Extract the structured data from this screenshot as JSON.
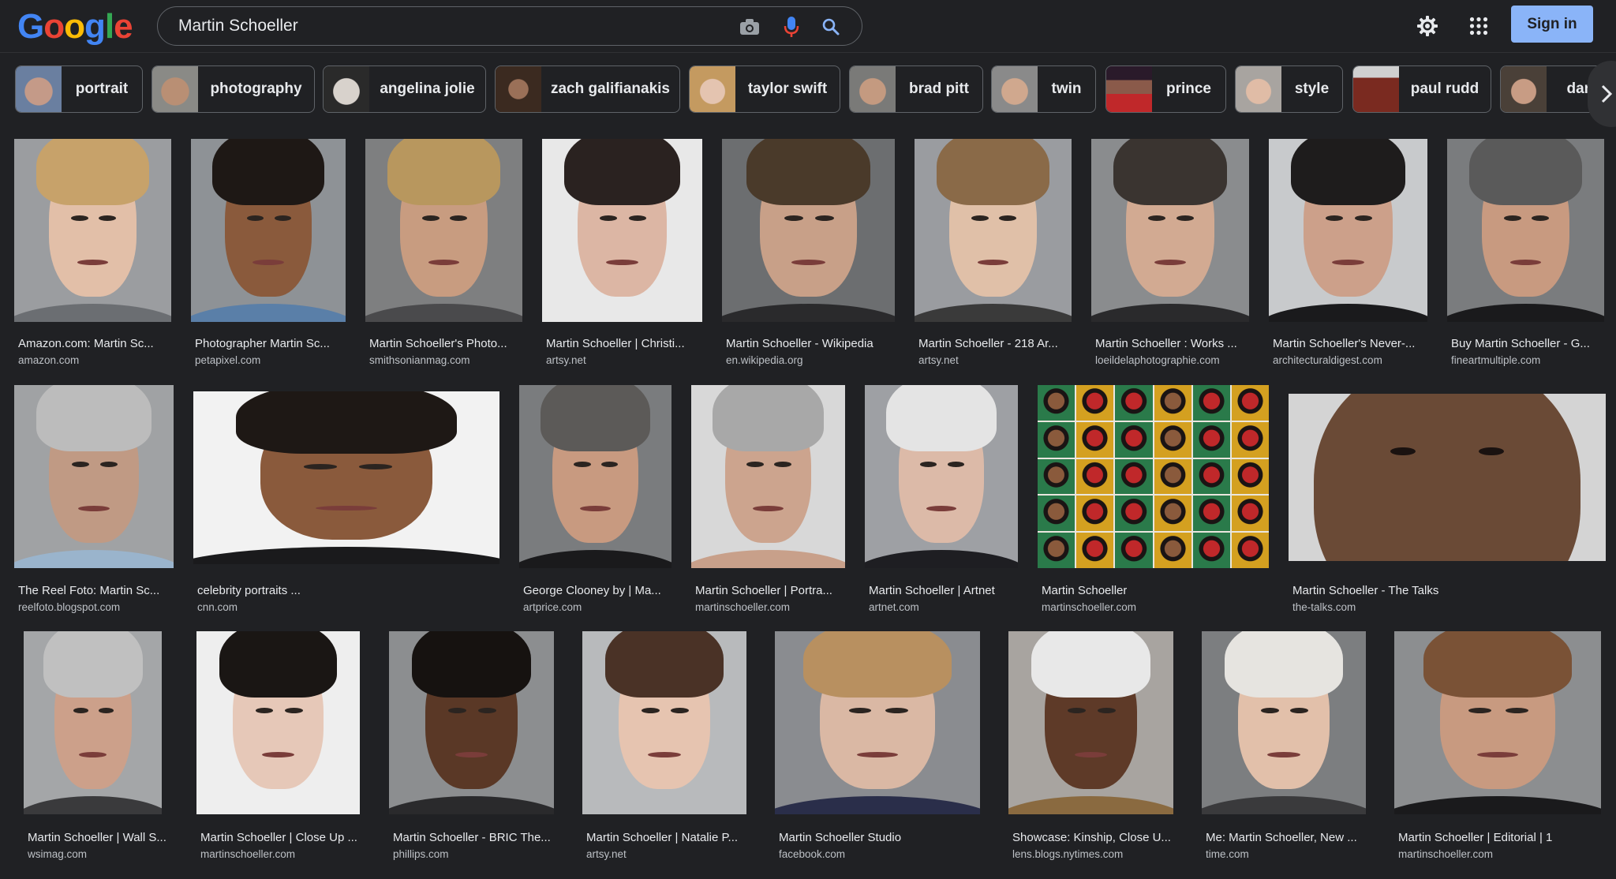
{
  "search": {
    "query": "Martin Schoeller"
  },
  "header": {
    "sign_in": "Sign in"
  },
  "logo": {
    "letters": [
      "G",
      "o",
      "o",
      "g",
      "l",
      "e"
    ]
  },
  "colors": {
    "accent": "#8ab4f8",
    "background": "#202124",
    "border": "#5f6368",
    "mic_blue": "#4285f4",
    "mic_red": "#ea4335"
  },
  "icons": {
    "camera": "camera-icon",
    "mic": "mic-icon",
    "search": "search-icon",
    "settings": "gear-icon",
    "apps": "apps-grid-icon",
    "next": "chevron-right-icon"
  },
  "chips": [
    {
      "label": "portrait"
    },
    {
      "label": "photography"
    },
    {
      "label": "angelina jolie"
    },
    {
      "label": "zach galifianakis"
    },
    {
      "label": "taylor swift"
    },
    {
      "label": "brad pitt"
    },
    {
      "label": "twin"
    },
    {
      "label": "prince"
    },
    {
      "label": "style"
    },
    {
      "label": "paul rudd"
    },
    {
      "label": "dani"
    }
  ],
  "results": [
    {
      "title": "Amazon.com: Martin Sc...",
      "source": "amazon.com"
    },
    {
      "title": "Photographer Martin Sc...",
      "source": "petapixel.com"
    },
    {
      "title": "Martin Schoeller's Photo...",
      "source": "smithsonianmag.com"
    },
    {
      "title": "Martin Schoeller | Christi...",
      "source": "artsy.net"
    },
    {
      "title": "Martin Schoeller - Wikipedia",
      "source": "en.wikipedia.org"
    },
    {
      "title": "Martin Schoeller - 218 Ar...",
      "source": "artsy.net"
    },
    {
      "title": "Martin Schoeller : Works ...",
      "source": "loeildelaphotographie.com"
    },
    {
      "title": "Martin Schoeller's Never-...",
      "source": "architecturaldigest.com"
    },
    {
      "title": "Buy Martin Schoeller - G...",
      "source": "fineartmultiple.com"
    },
    {
      "title": "The Reel Foto: Martin Sc...",
      "source": "reelfoto.blogspot.com"
    },
    {
      "title": "celebrity portraits ...",
      "source": "cnn.com"
    },
    {
      "title": "George Clooney by | Ma...",
      "source": "artprice.com"
    },
    {
      "title": "Martin Schoeller | Portra...",
      "source": "martinschoeller.com"
    },
    {
      "title": "Martin Schoeller | Artnet",
      "source": "artnet.com"
    },
    {
      "title": "Martin Schoeller",
      "source": "martinschoeller.com"
    },
    {
      "title": "Martin Schoeller - The Talks",
      "source": "the-talks.com"
    },
    {
      "title": "Martin Schoeller | Wall S...",
      "source": "wsimag.com"
    },
    {
      "title": "Martin Schoeller | Close Up ...",
      "source": "martinschoeller.com"
    },
    {
      "title": "Martin Schoeller - BRIC The...",
      "source": "phillips.com"
    },
    {
      "title": "Martin Schoeller | Natalie P...",
      "source": "artsy.net"
    },
    {
      "title": "Martin Schoeller Studio",
      "source": "facebook.com"
    },
    {
      "title": "Showcase: Kinship, Close U...",
      "source": "lens.blogs.nytimes.com"
    },
    {
      "title": "Me: Martin Schoeller, New ...",
      "source": "time.com"
    },
    {
      "title": "Martin Schoeller | Editorial | 1",
      "source": "martinschoeller.com"
    }
  ]
}
